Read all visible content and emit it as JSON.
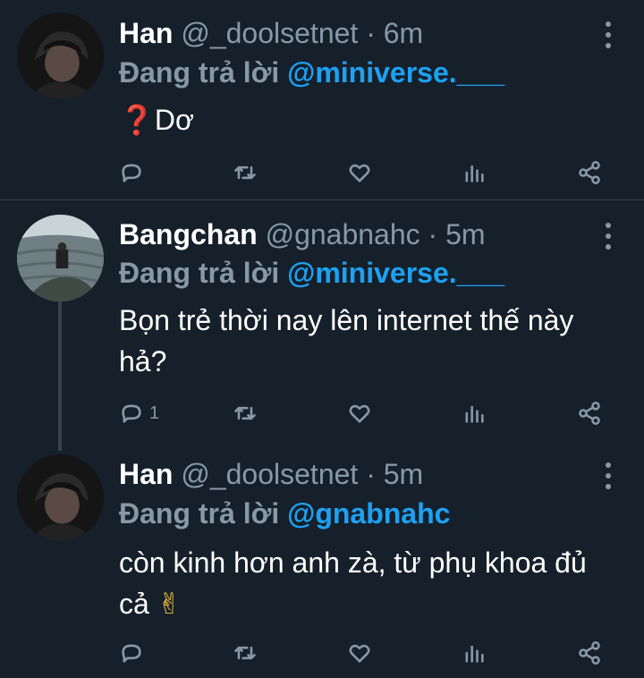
{
  "tweets": [
    {
      "name": "Han",
      "handle": "@_doolsetnet",
      "separator": " · ",
      "time": "6m",
      "reply_prefix": "Đang trả lời ",
      "reply_to": "@miniverse.___",
      "text_emoji": "❓",
      "text": "Dơ",
      "reply_count": ""
    },
    {
      "name": "Bangchan",
      "handle": "@gnabnahc",
      "separator": " · ",
      "time": "5m",
      "reply_prefix": "Đang trả lời ",
      "reply_to": "@miniverse.___",
      "text": "Bọn trẻ thời nay lên internet thế này hả?",
      "reply_count": "1"
    },
    {
      "name": "Han",
      "handle": "@_doolsetnet",
      "separator": " · ",
      "time": "5m",
      "reply_prefix": "Đang trả lời ",
      "reply_to": "@gnabnahc",
      "text": "còn kinh hơn anh zà, từ phụ khoa đủ cả",
      "text_emoji": "✌",
      "reply_count": ""
    }
  ],
  "colors": {
    "background": "#15202b",
    "text": "#ffffff",
    "muted": "#8899a6",
    "mention": "#1da1f2",
    "divider": "#38444d"
  },
  "icons": [
    "reply-icon",
    "retweet-icon",
    "like-icon",
    "analytics-icon",
    "share-icon",
    "more-icon"
  ]
}
